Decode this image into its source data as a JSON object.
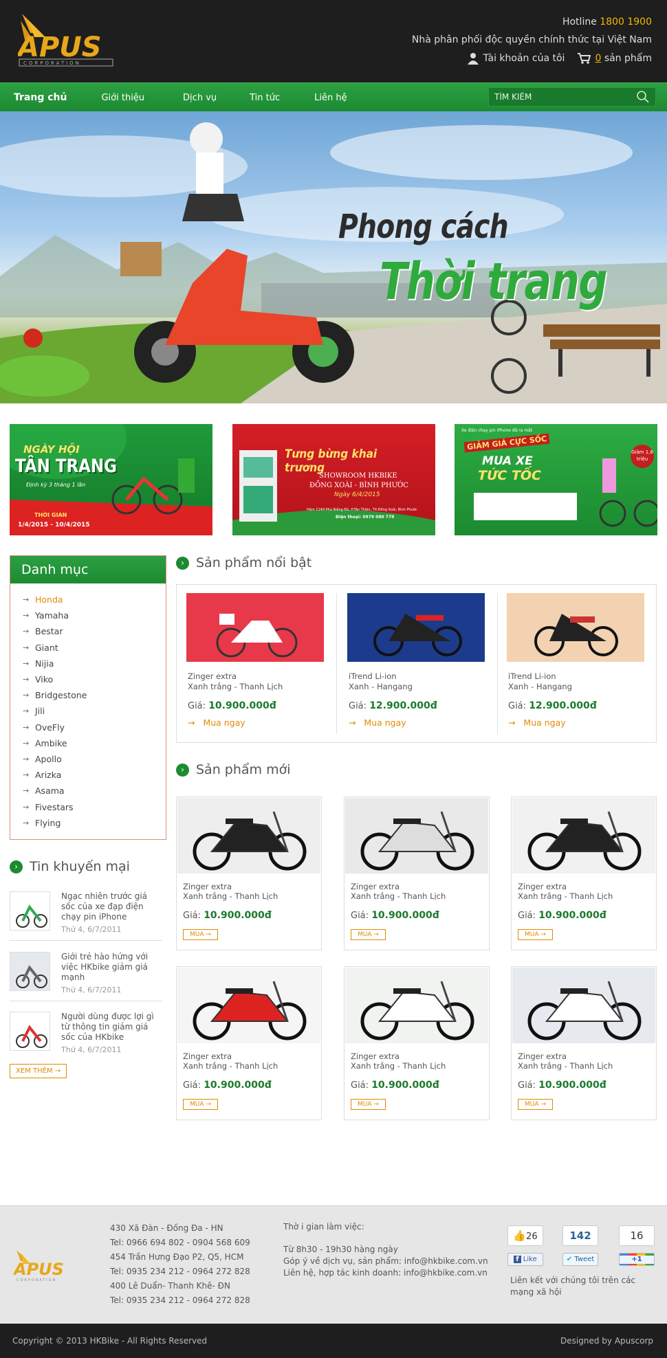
{
  "header": {
    "logo_text": "APUS",
    "logo_sub": "CORPORATION",
    "hotline_label": "Hotline",
    "hotline_number": "1800 1900",
    "distributor": "Nhà phân phối độc quyền chính thức tại Việt Nam",
    "account": "Tài khoản của tôi",
    "cart_count": "0",
    "cart_label": "sản phẩm"
  },
  "nav": {
    "items": [
      "Trang chủ",
      "Giới thiệu",
      "Dịch vụ",
      "Tin tức",
      "Liên hệ"
    ],
    "search_placeholder": "TÌM KIẾM"
  },
  "hero": {
    "line1": "Phong cách",
    "line2": "Thời trang"
  },
  "promos": [
    {
      "title": "NGÀY HỘI",
      "big": "TÂN TRANG",
      "sub": "Định kỳ 3 tháng 1 lần",
      "time_label": "THỜI GIAN",
      "time": "1/4/2015 - 10/4/2015"
    },
    {
      "title": "Tưng bừng khai trương",
      "l1": "SHOWROOM HKBIKE",
      "l2": "ĐỒNG XOÀI - BÌNH PHƯỚC",
      "l3": "Ngày 6/4/2015",
      "addr": "Hẻm 1140 Phú Riềng Đỏ, P.Tân Thiện, TX.Đồng Xoài, Bình Phước",
      "phone": "Điện thoại: 0979 080 779"
    },
    {
      "top": "Xe điện chạy pin iPhone đã ra mắt",
      "big1": "GIẢM GIÁ CỰC SỐC",
      "big2": "MUA XE",
      "big3": "TỨC TỐC",
      "badge": "Giảm 1,6 triệu"
    }
  ],
  "sidebar": {
    "title": "Danh mục",
    "categories": [
      "Honda",
      "Yamaha",
      "Bestar",
      "Giant",
      "Nijia",
      "Viko",
      "Bridgestone",
      "Jili",
      "OveFly",
      "Ambike",
      "Apollo",
      "Arizka",
      "Asama",
      "Fivestars",
      "Flying"
    ],
    "promo_title": "Tin khuyến mại",
    "news": [
      {
        "text": "Ngạc nhiên trước giá sốc của xe đạp điện chạy pin iPhone",
        "date": "Thứ 4, 6/7/2011"
      },
      {
        "text": "Giới trẻ hào hứng với việc HKbike giảm giá mạnh",
        "date": "Thứ 4, 6/7/2011"
      },
      {
        "text": "Người dùng được lợi gì từ thông tin giảm giá sốc của HKbike",
        "date": "Thứ 4, 6/7/2011"
      }
    ],
    "more": "XEM THÊM →"
  },
  "featured": {
    "title": "Sản phẩm nổi bật",
    "price_label": "Giá:",
    "buy": "Mua ngay",
    "items": [
      {
        "name": "Zinger extra",
        "color": "Xanh trắng - Thanh Lịch",
        "price": "10.900.000đ"
      },
      {
        "name": "iTrend Li-ion",
        "color": "Xanh - Hangang",
        "price": "12.900.000đ"
      },
      {
        "name": "iTrend Li-ion",
        "color": "Xanh - Hangang",
        "price": "12.900.000đ"
      }
    ]
  },
  "newproducts": {
    "title": "Sản phẩm mới",
    "price_label": "Giá:",
    "buy": "MUA →",
    "items": [
      {
        "name": "Zinger extra",
        "color": "Xanh trắng - Thanh Lịch",
        "price": "10.900.000đ"
      },
      {
        "name": "Zinger extra",
        "color": "Xanh trắng - Thanh Lịch",
        "price": "10.900.000đ"
      },
      {
        "name": "Zinger extra",
        "color": "Xanh trắng - Thanh Lịch",
        "price": "10.900.000đ"
      },
      {
        "name": "Zinger extra",
        "color": "Xanh trắng - Thanh Lịch",
        "price": "10.900.000đ"
      },
      {
        "name": "Zinger extra",
        "color": "Xanh trắng - Thanh Lịch",
        "price": "10.900.000đ"
      },
      {
        "name": "Zinger extra",
        "color": "Xanh trắng - Thanh Lịch",
        "price": "10.900.000đ"
      }
    ]
  },
  "footer": {
    "addresses": [
      "430 Xã Đàn - Đống Đa - HN",
      "Tel: 0966 694 802 - 0904 568 609",
      "454 Trần Hưng Đạo P2, Q5, HCM",
      "Tel: 0935 234 212 - 0964 272 828",
      "400 Lê Duẩn- Thanh Khê- ĐN",
      "Tel: 0935 234 212 - 0964 272 828"
    ],
    "hours_title": "Thờ i gian làm việc:",
    "hours": "Từ 8h30 - 19h30 hàng ngày",
    "feedback": "Góp ý về dịch vụ, sản phẩm: info@hkbike.com.vn",
    "contact": "Liên hệ, hợp tác kinh doanh: info@hkbike.com.vn",
    "fb_count": "26",
    "fb_label": "Like",
    "tw_count": "142",
    "tw_label": "Tweet",
    "gp_count": "16",
    "gp_label": "+1",
    "social_text": "Liên kết với chúng tôi trên các mạng xã hội",
    "copyright": "Copyright © 2013 HKBike - All Rights Reserved",
    "designed": "Designed by Apuscorp"
  },
  "colors": {
    "green": "#1c8a31",
    "orange": "#e08a00",
    "dark": "#1e1e1e",
    "price": "#1c7a2c"
  }
}
